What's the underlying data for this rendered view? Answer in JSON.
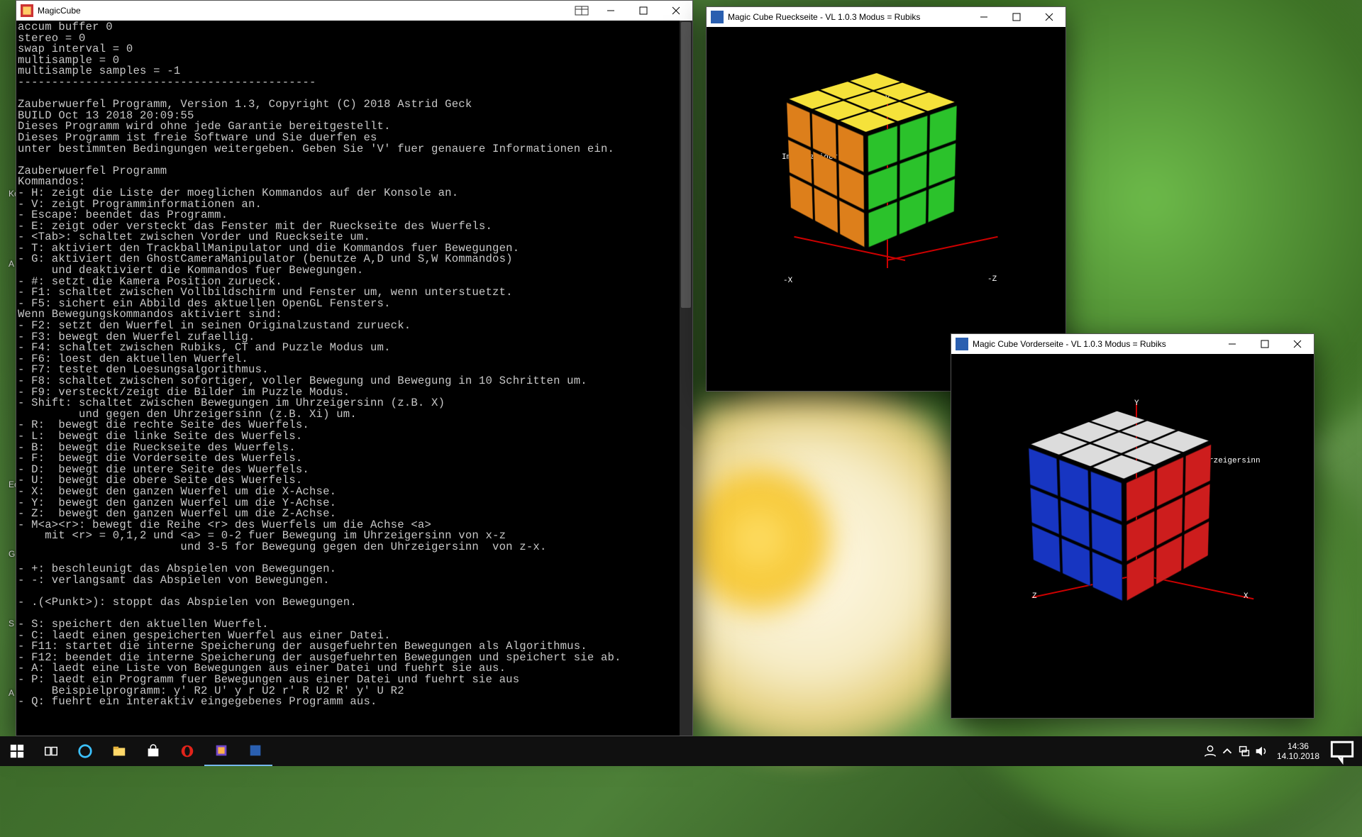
{
  "console": {
    "title": "MagicCube",
    "text": "accum buffer 0\nstereo = 0\nswap interval = 0\nmultisample = 0\nmultisample samples = -1\n--------------------------------------------\n\nZauberwuerfel Programm, Version 1.3, Copyright (C) 2018 Astrid Geck\nBUILD Oct 13 2018 20:09:55\nDieses Programm wird ohne jede Garantie bereitgestellt.\nDieses Programm ist freie Software und Sie duerfen es\nunter bestimmten Bedingungen weitergeben. Geben Sie 'V' fuer genauere Informationen ein.\n\nZauberwuerfel Programm\nKommandos:\n- H: zeigt die Liste der moeglichen Kommandos auf der Konsole an.\n- V: zeigt Programminformationen an.\n- Escape: beendet das Programm.\n- E: zeigt oder versteckt das Fenster mit der Rueckseite des Wuerfels.\n- <Tab>: schaltet zwischen Vorder und Rueckseite um.\n- T: aktiviert den TrackballManipulator und die Kommandos fuer Bewegungen.\n- G: aktiviert den GhostCameraManipulator (benutze A,D und S,W Kommandos)\n     und deaktiviert die Kommandos fuer Bewegungen.\n- #: setzt die Kamera Position zurueck.\n- F1: schaltet zwischen Vollbildschirm und Fenster um, wenn unterstuetzt.\n- F5: sichert ein Abbild des aktuellen OpenGL Fensters.\nWenn Bewegungskommandos aktiviert sind:\n- F2: setzt den Wuerfel in seinen Originalzustand zurueck.\n- F3: bewegt den Wuerfel zufaellig.\n- F4: schaltet zwischen Rubiks, CT and Puzzle Modus um.\n- F6: loest den aktuellen Wuerfel.\n- F7: testet den Loesungsalgorithmus.\n- F8: schaltet zwischen sofortiger, voller Bewegung und Bewegung in 10 Schritten um.\n- F9: versteckt/zeigt die Bilder im Puzzle Modus.\n- Shift: schaltet zwischen Bewegungen im Uhrzeigersinn (z.B. X)\n         und gegen den Uhrzeigersinn (z.B. Xi) um.\n- R:  bewegt die rechte Seite des Wuerfels.\n- L:  bewegt die linke Seite des Wuerfels.\n- B:  bewegt die Rueckseite des Wuerfels.\n- F:  bewegt die Vorderseite des Wuerfels.\n- D:  bewegt die untere Seite des Wuerfels.\n- U:  bewegt die obere Seite des Wuerfels.\n- X:  bewegt den ganzen Wuerfel um die X-Achse.\n- Y:  bewegt den ganzen Wuerfel um die Y-Achse.\n- Z:  bewegt den ganzen Wuerfel um die Z-Achse.\n- M<a><r>: bewegt die Reihe <r> des Wuerfels um die Achse <a>\n    mit <r> = 0,1,2 und <a> = 0-2 fuer Bewegung im Uhrzeigersinn von x-z\n                        und 3-5 for Bewegung gegen den Uhrzeigersinn  von z-x.\n\n- +: beschleunigt das Abspielen von Bewegungen.\n- -: verlangsamt das Abspielen von Bewegungen.\n\n- .(<Punkt>): stoppt das Abspielen von Bewegungen.\n\n- S: speichert den aktuellen Wuerfel.\n- C: laedt einen gespeicherten Wuerfel aus einer Datei.\n- F11: startet die interne Speicherung der ausgefuehrten Bewegungen als Algorithmus.\n- F12: beendet die interne Speicherung der ausgefuehrten Bewegungen und speichert sie ab.\n- A: laedt eine Liste von Bewegungen aus einer Datei und fuehrt sie aus.\n- P: laedt ein Programm fuer Bewegungen aus einer Datei und fuehrt sie aus\n     Beispielprogramm: y' R2 U' y r U2 r' R U2 R' y' U R2\n- Q: fuehrt ein interaktiv eingegebenes Programm aus."
  },
  "back": {
    "title": "Magic Cube Rueckseite - VL 1.0.3 Modus = Rubiks",
    "direction_label": "Im Uhrzeigersinn",
    "axis": {
      "x": "-X",
      "y": "Y",
      "z": "-Z"
    },
    "face_colors": {
      "top": "#f5e23a",
      "left": "#f08a1d",
      "right": "#2cc82c"
    }
  },
  "front": {
    "title": "Magic Cube Vorderseite - VL 1.0.3 Modus = Rubiks",
    "direction_label": "Im Uhrzeigersinn",
    "axis": {
      "x": "X",
      "y": "Y",
      "z": "Z"
    },
    "face_colors": {
      "top": "#dcdcdc",
      "left": "#1a3bd6",
      "right": "#d81e1e"
    }
  },
  "taskbar": {
    "time": "14:36",
    "date": "14.10.2018"
  },
  "desktop_hints": [
    "Ko",
    "A",
    "Ecl",
    "G",
    "S",
    "A"
  ]
}
